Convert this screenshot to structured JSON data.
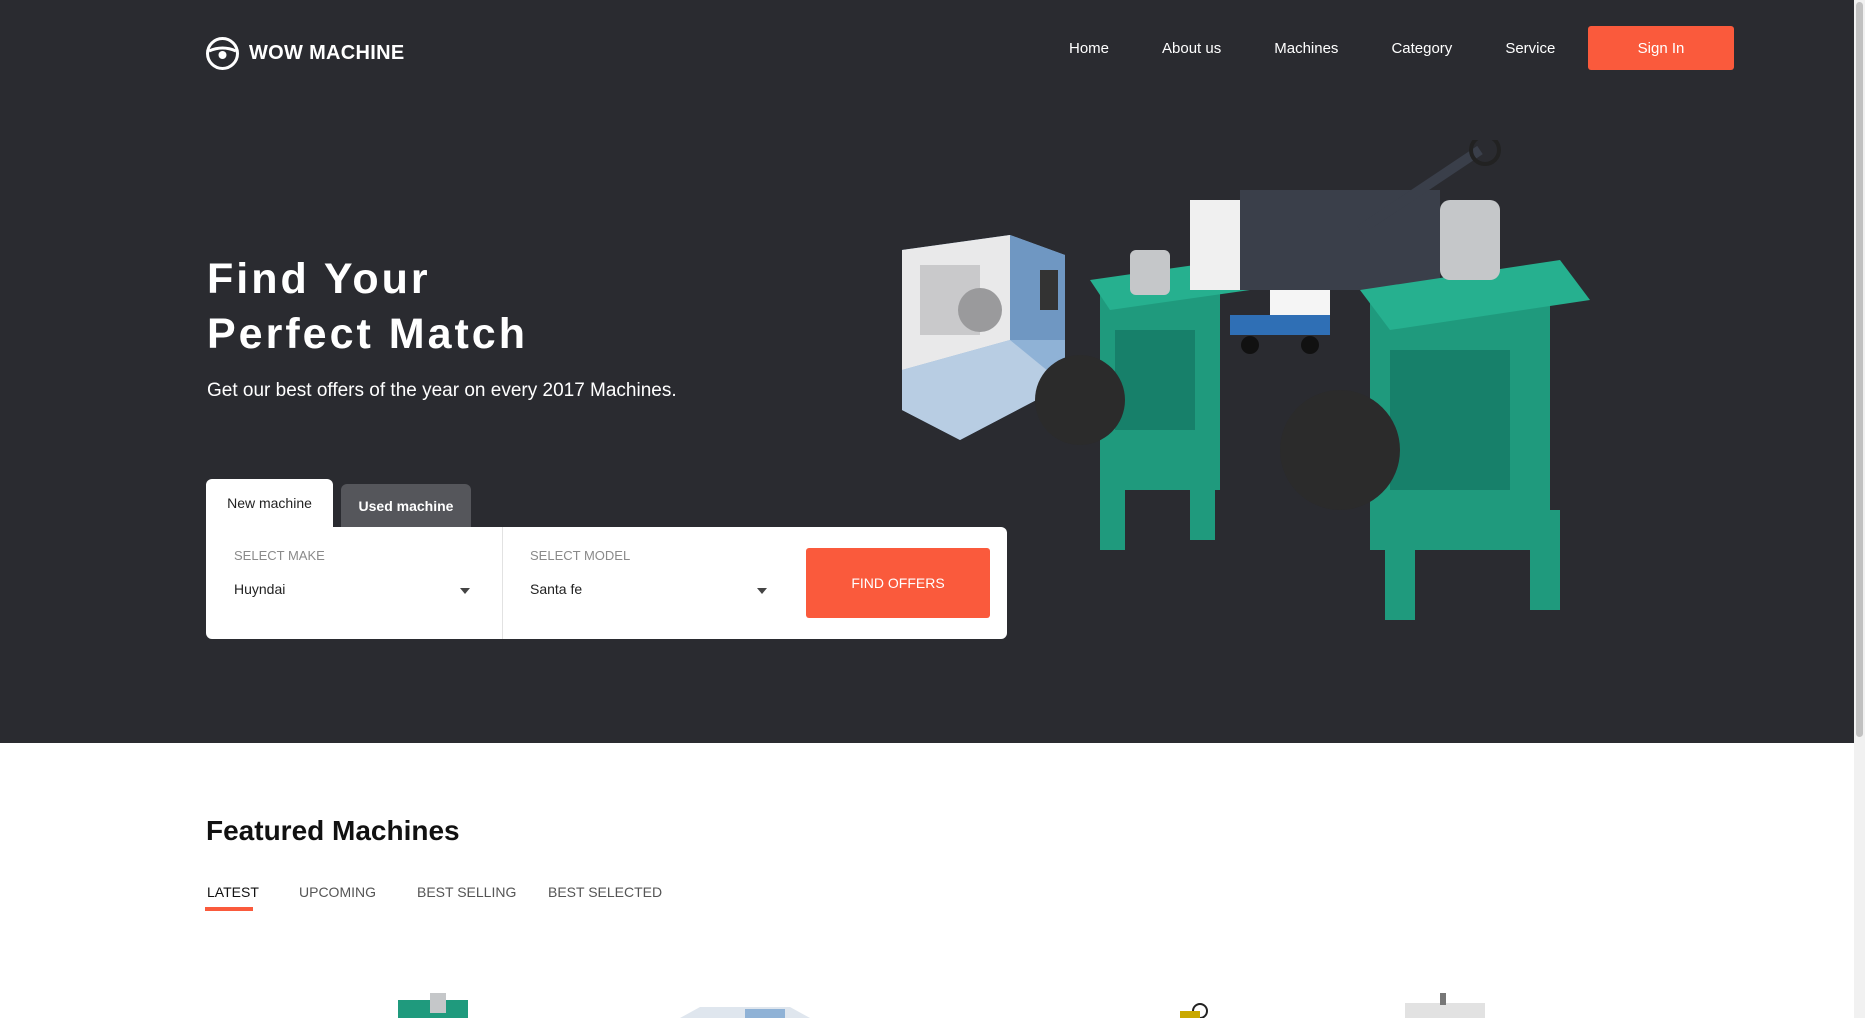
{
  "brand": {
    "name": "WOW MACHINE",
    "logo_icon": "steering-wheel-icon"
  },
  "nav": {
    "items": [
      {
        "label": "Home"
      },
      {
        "label": "About us"
      },
      {
        "label": "Machines"
      },
      {
        "label": "Category"
      },
      {
        "label": "Service"
      }
    ],
    "sign_in_label": "Sign In"
  },
  "hero": {
    "title_line1": "Find Your",
    "title_line2": "Perfect Match",
    "subtitle": "Get our best offers of the year on every 2017 Machines."
  },
  "search": {
    "tabs": [
      {
        "label": "New machine",
        "active": true
      },
      {
        "label": "Used machine",
        "active": false
      }
    ],
    "make": {
      "label": "SELECT MAKE",
      "value": "Huyndai"
    },
    "model": {
      "label": "SELECT MODEL",
      "value": "Santa fe"
    },
    "submit_label": "FIND OFFERS"
  },
  "featured": {
    "title": "Featured Machines",
    "tabs": [
      {
        "label": "LATEST",
        "active": true
      },
      {
        "label": "UPCOMING",
        "active": false
      },
      {
        "label": "BEST SELLING",
        "active": false
      },
      {
        "label": "BEST SELECTED",
        "active": false
      }
    ]
  },
  "colors": {
    "hero_bg": "#2a2b30",
    "accent": "#fa5a3c",
    "machine_green": "#1f9a7d",
    "tab_inactive": "#55565b"
  }
}
